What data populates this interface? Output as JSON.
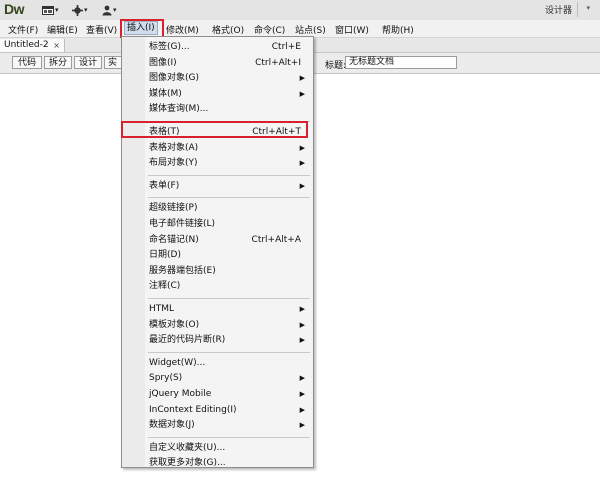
{
  "app": {
    "logo": "Dw",
    "workspace_label": "设计器"
  },
  "appbar": {
    "layout_icon": "layout-icon",
    "gear_icon": "gear-icon",
    "user_icon": "user-icon"
  },
  "menubar": [
    {
      "label": "文件(F)"
    },
    {
      "label": "编辑(E)"
    },
    {
      "label": "查看(V)"
    },
    {
      "label": "插入(I)",
      "active": true
    },
    {
      "label": "修改(M)"
    },
    {
      "label": "格式(O)"
    },
    {
      "label": "命令(C)"
    },
    {
      "label": "站点(S)"
    },
    {
      "label": "窗口(W)"
    },
    {
      "label": "帮助(H)"
    }
  ],
  "document_tab": {
    "name": "Untitled-2",
    "close": "×"
  },
  "toolbar": {
    "code": "代码",
    "split": "拆分",
    "design": "设计",
    "live": "实时",
    "title_label": "标题:",
    "title_value": "无标题文档"
  },
  "insert_menu": {
    "groups": [
      [
        {
          "label": "标签(G)...",
          "shortcut": "Ctrl+E"
        },
        {
          "label": "图像(I)",
          "shortcut": "Ctrl+Alt+I"
        },
        {
          "label": "图像对象(G)",
          "submenu": true
        },
        {
          "label": "媒体(M)",
          "submenu": true
        },
        {
          "label": "媒体查询(M)..."
        }
      ],
      [
        {
          "label": "表格(T)",
          "shortcut": "Ctrl+Alt+T",
          "highlighted": true
        },
        {
          "label": "表格对象(A)",
          "submenu": true
        },
        {
          "label": "布局对象(Y)",
          "submenu": true
        }
      ],
      [
        {
          "label": "表单(F)",
          "submenu": true
        }
      ],
      [
        {
          "label": "超级链接(P)"
        },
        {
          "label": "电子邮件链接(L)"
        },
        {
          "label": "命名锚记(N)",
          "shortcut": "Ctrl+Alt+A"
        },
        {
          "label": "日期(D)"
        },
        {
          "label": "服务器端包括(E)"
        },
        {
          "label": "注释(C)"
        }
      ],
      [
        {
          "label": "HTML",
          "submenu": true
        },
        {
          "label": "模板对象(O)",
          "submenu": true
        },
        {
          "label": "最近的代码片断(R)",
          "submenu": true
        }
      ],
      [
        {
          "label": "Widget(W)..."
        },
        {
          "label": "Spry(S)",
          "submenu": true
        },
        {
          "label": "jQuery Mobile",
          "submenu": true
        },
        {
          "label": "InContext Editing(I)",
          "submenu": true
        },
        {
          "label": "数据对象(J)",
          "submenu": true
        }
      ],
      [
        {
          "label": "自定义收藏夹(U)..."
        },
        {
          "label": "获取更多对象(G)..."
        }
      ]
    ]
  },
  "colors": {
    "highlight_box": "#d8212d",
    "logo": "#35461c"
  }
}
